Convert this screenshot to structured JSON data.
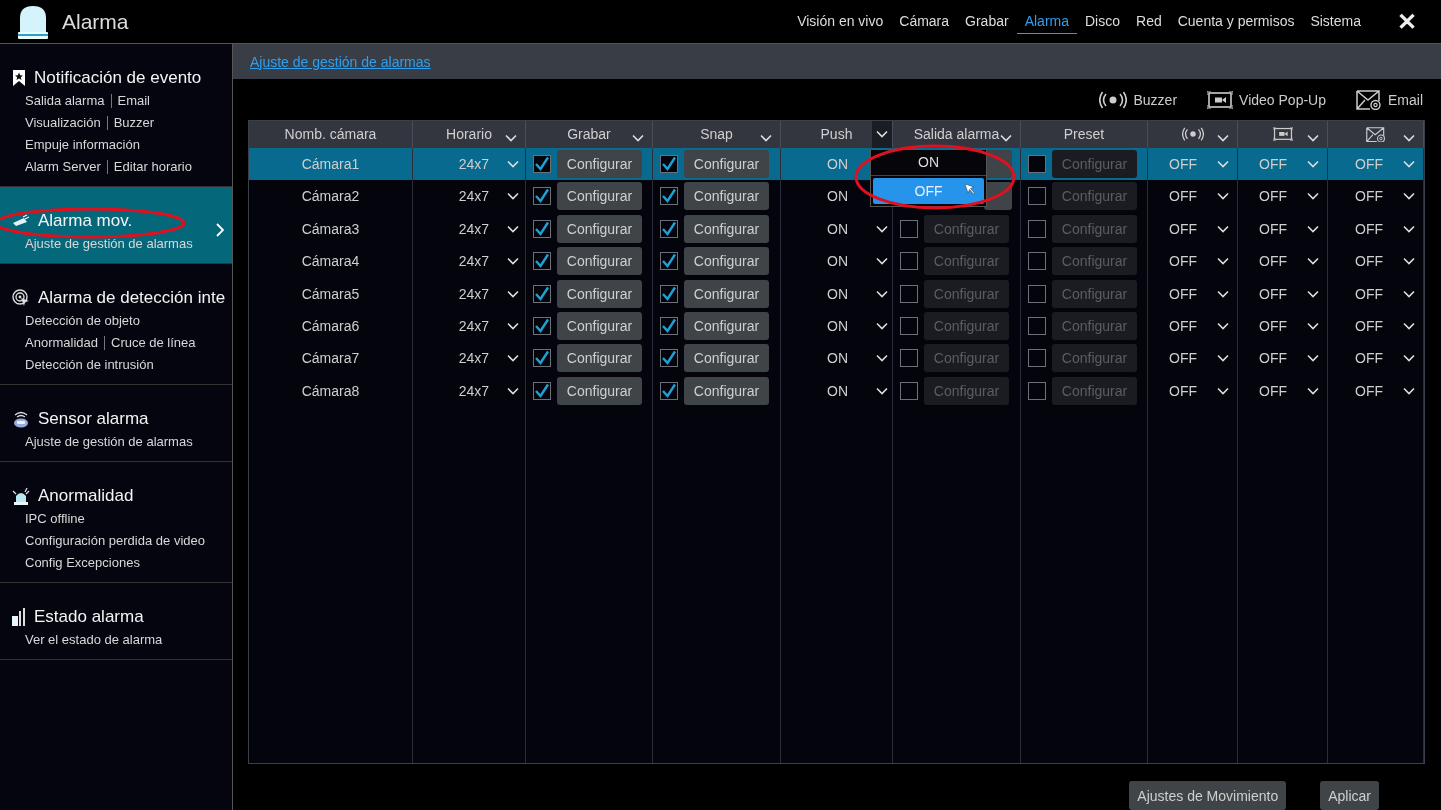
{
  "app": {
    "title": "Alarma"
  },
  "nav": [
    {
      "label": "Visión en vivo",
      "selected": false
    },
    {
      "label": "Cámara",
      "selected": false
    },
    {
      "label": "Grabar",
      "selected": false
    },
    {
      "label": "Alarma",
      "selected": true
    },
    {
      "label": "Disco",
      "selected": false
    },
    {
      "label": "Red",
      "selected": false
    },
    {
      "label": "Cuenta y permisos",
      "selected": false
    },
    {
      "label": "Sistema",
      "selected": false
    }
  ],
  "close": "✕",
  "sidebar": [
    {
      "title": "Notificación de evento",
      "selected": false,
      "circled": false,
      "lines": [
        [
          "Salida alarma",
          "Email"
        ],
        [
          "Visualización",
          "Buzzer"
        ],
        [
          "Empuje información"
        ],
        [
          "Alarm Server",
          "Editar horario"
        ]
      ]
    },
    {
      "title": "Alarma mov.",
      "selected": true,
      "circled": true,
      "lines": [
        [
          "Ajuste de gestión de alarmas"
        ]
      ]
    },
    {
      "title": "Alarma de detección inte",
      "selected": false,
      "circled": false,
      "lines": [
        [
          "Detección de objeto"
        ],
        [
          "Anormalidad",
          "Cruce de línea"
        ],
        [
          "Detección de intrusión"
        ]
      ]
    },
    {
      "title": "Sensor alarma",
      "selected": false,
      "circled": false,
      "lines": [
        [
          "Ajuste de gestión de alarmas"
        ]
      ]
    },
    {
      "title": "Anormalidad",
      "selected": false,
      "circled": false,
      "lines": [
        [
          "IPC offline"
        ],
        [
          "Configuración perdida de video"
        ],
        [
          "Config Excepciones"
        ]
      ]
    },
    {
      "title": "Estado alarma",
      "selected": false,
      "circled": false,
      "lines": [
        [
          "Ver el estado de alarma"
        ]
      ]
    }
  ],
  "breadcrumb": "Ajuste de gestión de alarmas",
  "legend": [
    {
      "label": "Buzzer"
    },
    {
      "label": "Video Pop-Up"
    },
    {
      "label": "Email"
    }
  ],
  "table": {
    "columns": [
      {
        "kind": "text",
        "label": "Nomb. cámara",
        "dropdown": false,
        "open": false
      },
      {
        "kind": "text",
        "label": "Horario",
        "dropdown": true,
        "open": false
      },
      {
        "kind": "text",
        "label": "Grabar",
        "dropdown": true,
        "open": false
      },
      {
        "kind": "text",
        "label": "Snap",
        "dropdown": true,
        "open": false
      },
      {
        "kind": "text",
        "label": "Push",
        "dropdown": true,
        "open": true
      },
      {
        "kind": "text",
        "label": "Salida alarma",
        "dropdown": true,
        "open": false
      },
      {
        "kind": "text",
        "label": "Preset",
        "dropdown": false,
        "open": false
      },
      {
        "kind": "icon",
        "dropdown": true,
        "open": false
      },
      {
        "kind": "icon",
        "dropdown": true,
        "open": false
      },
      {
        "kind": "icon",
        "dropdown": true,
        "open": false
      }
    ],
    "rows": [
      {
        "name": "Cámara1",
        "selected": true,
        "schedule": "24x7",
        "record": {
          "checked": true,
          "button": "Configurar"
        },
        "snap": {
          "checked": true,
          "button": "Configurar"
        },
        "push": "ON",
        "alarm_out": {
          "covered": true
        },
        "preset": {
          "checked": false,
          "button": "Configurar"
        },
        "buzzer": "OFF",
        "popup": "OFF",
        "email": "OFF"
      },
      {
        "name": "Cámara2",
        "selected": false,
        "schedule": "24x7",
        "record": {
          "checked": true,
          "button": "Configurar"
        },
        "snap": {
          "checked": true,
          "button": "Configurar"
        },
        "push": "ON",
        "alarm_out": {
          "covered": true
        },
        "preset": {
          "checked": false,
          "button": "Configurar"
        },
        "buzzer": "OFF",
        "popup": "OFF",
        "email": "OFF"
      },
      {
        "name": "Cámara3",
        "selected": false,
        "schedule": "24x7",
        "record": {
          "checked": true,
          "button": "Configurar"
        },
        "snap": {
          "checked": true,
          "button": "Configurar"
        },
        "push": "ON",
        "alarm_out": {
          "checked": false,
          "button": "Configurar"
        },
        "preset": {
          "checked": false,
          "button": "Configurar"
        },
        "buzzer": "OFF",
        "popup": "OFF",
        "email": "OFF"
      },
      {
        "name": "Cámara4",
        "selected": false,
        "schedule": "24x7",
        "record": {
          "checked": true,
          "button": "Configurar"
        },
        "snap": {
          "checked": true,
          "button": "Configurar"
        },
        "push": "ON",
        "alarm_out": {
          "checked": false,
          "button": "Configurar"
        },
        "preset": {
          "checked": false,
          "button": "Configurar"
        },
        "buzzer": "OFF",
        "popup": "OFF",
        "email": "OFF"
      },
      {
        "name": "Cámara5",
        "selected": false,
        "schedule": "24x7",
        "record": {
          "checked": true,
          "button": "Configurar"
        },
        "snap": {
          "checked": true,
          "button": "Configurar"
        },
        "push": "ON",
        "alarm_out": {
          "checked": false,
          "button": "Configurar"
        },
        "preset": {
          "checked": false,
          "button": "Configurar"
        },
        "buzzer": "OFF",
        "popup": "OFF",
        "email": "OFF"
      },
      {
        "name": "Cámara6",
        "selected": false,
        "schedule": "24x7",
        "record": {
          "checked": true,
          "button": "Configurar"
        },
        "snap": {
          "checked": true,
          "button": "Configurar"
        },
        "push": "ON",
        "alarm_out": {
          "checked": false,
          "button": "Configurar"
        },
        "preset": {
          "checked": false,
          "button": "Configurar"
        },
        "buzzer": "OFF",
        "popup": "OFF",
        "email": "OFF"
      },
      {
        "name": "Cámara7",
        "selected": false,
        "schedule": "24x7",
        "record": {
          "checked": true,
          "button": "Configurar"
        },
        "snap": {
          "checked": true,
          "button": "Configurar"
        },
        "push": "ON",
        "alarm_out": {
          "checked": false,
          "button": "Configurar"
        },
        "preset": {
          "checked": false,
          "button": "Configurar"
        },
        "buzzer": "OFF",
        "popup": "OFF",
        "email": "OFF"
      },
      {
        "name": "Cámara8",
        "selected": false,
        "schedule": "24x7",
        "record": {
          "checked": true,
          "button": "Configurar"
        },
        "snap": {
          "checked": true,
          "button": "Configurar"
        },
        "push": "ON",
        "alarm_out": {
          "checked": false,
          "button": "Configurar"
        },
        "preset": {
          "checked": false,
          "button": "Configurar"
        },
        "buzzer": "OFF",
        "popup": "OFF",
        "email": "OFF"
      }
    ]
  },
  "push_menu": {
    "circled": true,
    "options": [
      {
        "label": "ON",
        "selected": false
      },
      {
        "label": "OFF",
        "selected": true
      }
    ]
  },
  "buttons": [
    {
      "label": "Ajustes de Movimiento"
    },
    {
      "label": "Aplicar"
    }
  ]
}
